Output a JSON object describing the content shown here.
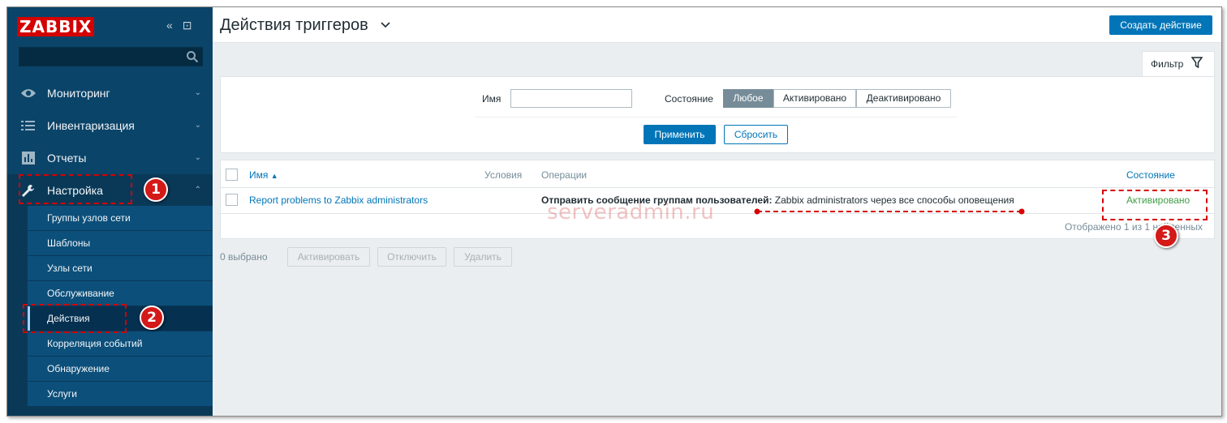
{
  "sidebar": {
    "logo": "ZABBIX",
    "collapse_glyph": "«",
    "kiosk_glyph": "⊡",
    "search_placeholder": "",
    "menu": [
      {
        "label": "Мониторинг",
        "icon": "eye-icon",
        "caret": "⌄"
      },
      {
        "label": "Инвентаризация",
        "icon": "list-icon",
        "caret": "⌄"
      },
      {
        "label": "Отчеты",
        "icon": "bar-chart-icon",
        "caret": "⌄"
      },
      {
        "label": "Настройка",
        "icon": "wrench-icon",
        "caret": "⌃"
      }
    ],
    "submenu": [
      "Группы узлов сети",
      "Шаблоны",
      "Узлы сети",
      "Обслуживание",
      "Действия",
      "Корреляция событий",
      "Обнаружение",
      "Услуги"
    ]
  },
  "annotations": {
    "badge1": "1",
    "badge2": "2",
    "badge3": "3"
  },
  "header": {
    "title": "Действия триггеров",
    "create_button": "Создать действие"
  },
  "filter": {
    "tab_label": "Фильтр",
    "name_label": "Имя",
    "name_value": "",
    "state_label": "Состояние",
    "state_options": [
      "Любое",
      "Активировано",
      "Деактивировано"
    ],
    "state_selected": "Любое",
    "apply_button": "Применить",
    "reset_button": "Сбросить"
  },
  "table": {
    "columns": {
      "name": "Имя",
      "sort_glyph": "▲",
      "conditions": "Условия",
      "operations": "Операции",
      "status": "Состояние"
    },
    "rows": [
      {
        "name": "Report problems to Zabbix administrators",
        "conditions": "",
        "operation_bold": "Отправить сообщение группам пользователей:",
        "operation_rest": "Zabbix administrators через все способы оповещения",
        "status": "Активировано"
      }
    ],
    "footer": "Отображено 1 из 1 найденных"
  },
  "watermark": "serveradmin.ru",
  "mass_actions": {
    "selected_count": "0 выбрано",
    "enable": "Активировать",
    "disable": "Отключить",
    "delete": "Удалить"
  },
  "colors": {
    "sidebar_bg": "#0b4469",
    "accent": "#0275b8",
    "logo_red": "#d40000",
    "status_green": "#429e47",
    "annotation_red": "#d70000"
  }
}
